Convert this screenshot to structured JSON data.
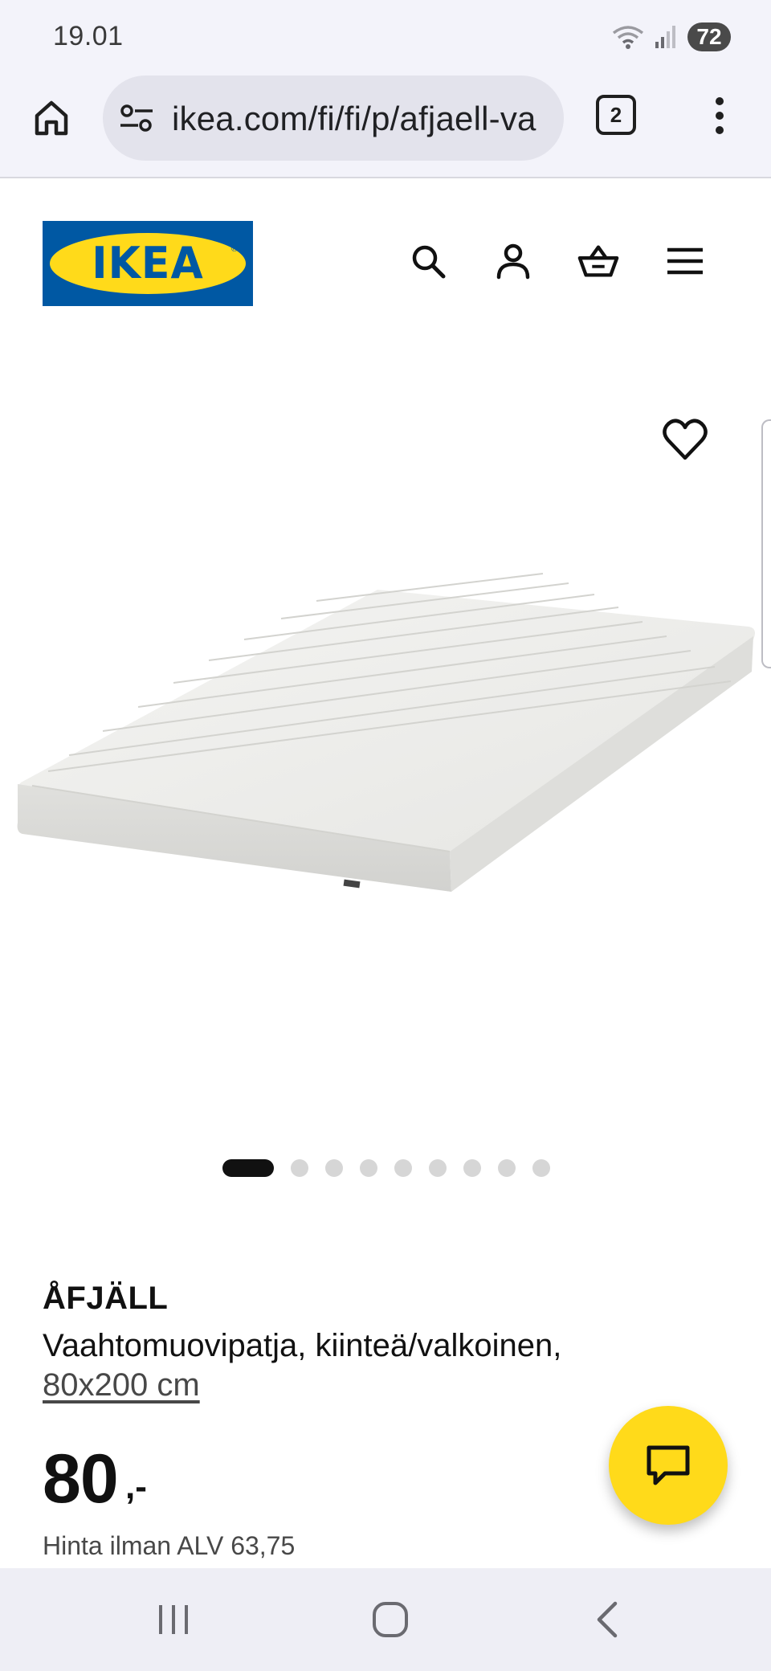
{
  "status_bar": {
    "time": "19.01",
    "battery": "72",
    "icons": [
      "wifi-icon",
      "signal-icon",
      "battery-icon"
    ]
  },
  "browser": {
    "url": "ikea.com/fi/fi/p/afjaell-va",
    "tab_count": "2",
    "icons": [
      "home-icon",
      "site-settings-icon",
      "more-vert-icon"
    ]
  },
  "header": {
    "logo_text": "IKEA",
    "icons": [
      "search-icon",
      "account-icon",
      "basket-icon",
      "hamburger-menu-icon"
    ]
  },
  "carousel": {
    "image_description_icon": "mattress-image",
    "total_images": 9,
    "active_index": 0
  },
  "product": {
    "name": "ÅFJÄLL",
    "description": "Vaahtomuovipatja, kiinteä/valkoinen,",
    "size": "80x200 cm",
    "price": "80",
    "price_suffix": ",-",
    "price_note": "Hinta ilman ALV 63,75"
  },
  "colors": {
    "ikea_blue": "#0058a3",
    "ikea_yellow": "#ffda1a",
    "text": "#111111",
    "browser_chrome": "#f3f3fa"
  }
}
